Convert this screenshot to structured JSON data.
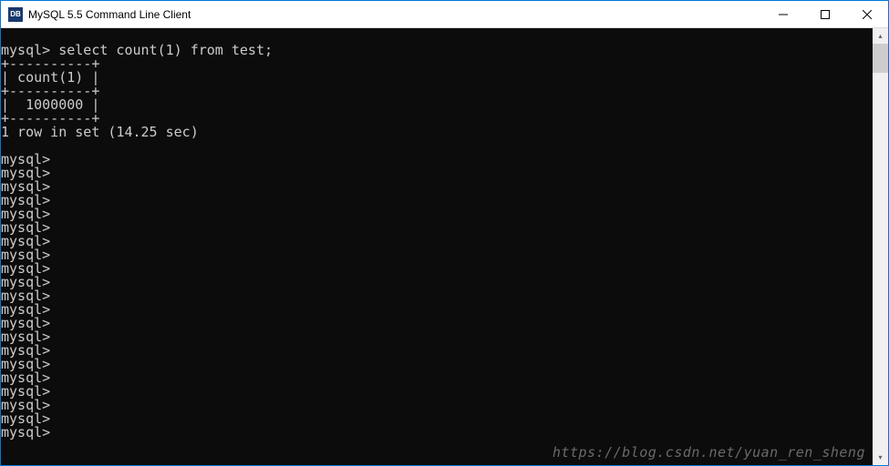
{
  "window": {
    "title": "MySQL 5.5 Command Line Client",
    "icon_label": "DB"
  },
  "terminal": {
    "prompt": "mysql>",
    "query": "select count(1) from test;",
    "border_top": "+----------+",
    "header_row": "| count(1) |",
    "border_mid": "+----------+",
    "value_row": "|  1000000 |",
    "border_bot": "+----------+",
    "result_status": "1 row in set (14.25 sec)",
    "empty_prompts_count": 21
  },
  "watermark": "https://blog.csdn.net/yuan_ren_sheng"
}
